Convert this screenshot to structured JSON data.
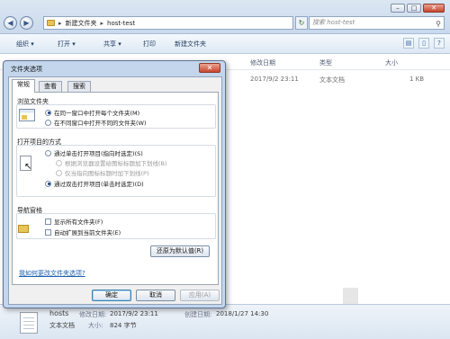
{
  "explorer": {
    "breadcrumb": [
      "新建文件夹",
      "host-test"
    ],
    "search_placeholder": "搜索 host-test",
    "toolbar": {
      "organize": "组织 ▾",
      "open": "打开 ▾",
      "share": "共享 ▾",
      "print": "打印",
      "new_folder": "新建文件夹"
    },
    "columns": {
      "modified": "修改日期",
      "type": "类型",
      "size": "大小"
    },
    "rows": [
      {
        "modified": "2017/9/2 23:11",
        "type": "文本文档",
        "size": "1 KB"
      }
    ],
    "status": {
      "name": "hosts",
      "modified_label": "修改日期:",
      "modified": "2017/9/2 23:11",
      "created_label": "创建日期:",
      "created": "2018/1/27 14:30",
      "type": "文本文档",
      "size_label": "大小:",
      "size": "824 字节"
    }
  },
  "dialog": {
    "title": "文件夹选项",
    "close": "✕",
    "tabs": [
      "常规",
      "查看",
      "搜索"
    ],
    "browse": {
      "title": "浏览文件夹",
      "options": [
        "在同一窗口中打开每个文件夹(M)",
        "在不同窗口中打开不同的文件夹(W)"
      ]
    },
    "click": {
      "title": "打开项目的方式",
      "options": [
        "通过单击打开项目(指向时选定)(S)",
        "根据浏览器设置给图标标题加下划线(B)",
        "仅当指向图标标题时加下划线(P)",
        "通过双击打开项目(单击时选定)(D)"
      ]
    },
    "nav": {
      "title": "导航窗格",
      "options": [
        "显示所有文件夹(F)",
        "自动扩展到当前文件夹(E)"
      ]
    },
    "restore_defaults": "还原为默认值(R)",
    "help_link": "我如何更改文件夹选项?",
    "buttons": {
      "ok": "确定",
      "cancel": "取消",
      "apply": "应用(A)"
    }
  }
}
